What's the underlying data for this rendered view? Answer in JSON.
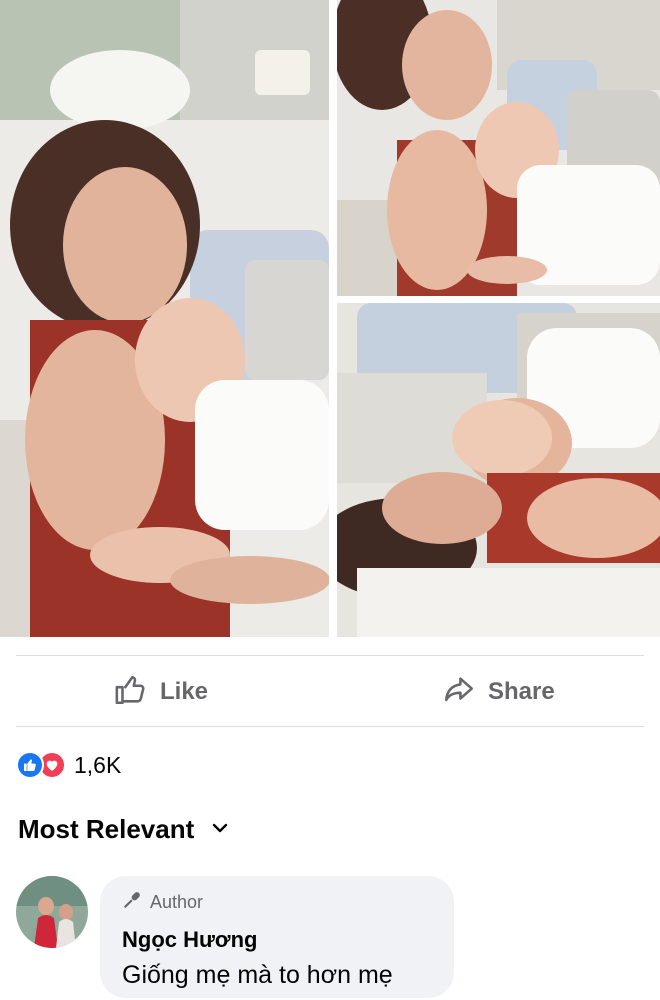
{
  "post": {
    "photos": [
      {
        "name": "grandmother-and-baby-selfie"
      },
      {
        "name": "grandmother-hugging-sleeping-baby"
      },
      {
        "name": "baby-sleeping-on-grandmother"
      }
    ]
  },
  "actions": {
    "like_label": "Like",
    "share_label": "Share"
  },
  "reactions": {
    "icons": [
      "like-icon",
      "love-icon"
    ],
    "count": "1,6K"
  },
  "comments": {
    "sort_label": "Most Relevant",
    "items": [
      {
        "badge": "Author",
        "name": "Ngọc Hương",
        "text": "Giống mẹ mà to hơn mẹ"
      }
    ]
  },
  "colors": {
    "like_blue": "#1877f2",
    "love_red": "#f33e58",
    "muted_text": "#65676b",
    "bubble_bg": "#f0f2f5"
  }
}
